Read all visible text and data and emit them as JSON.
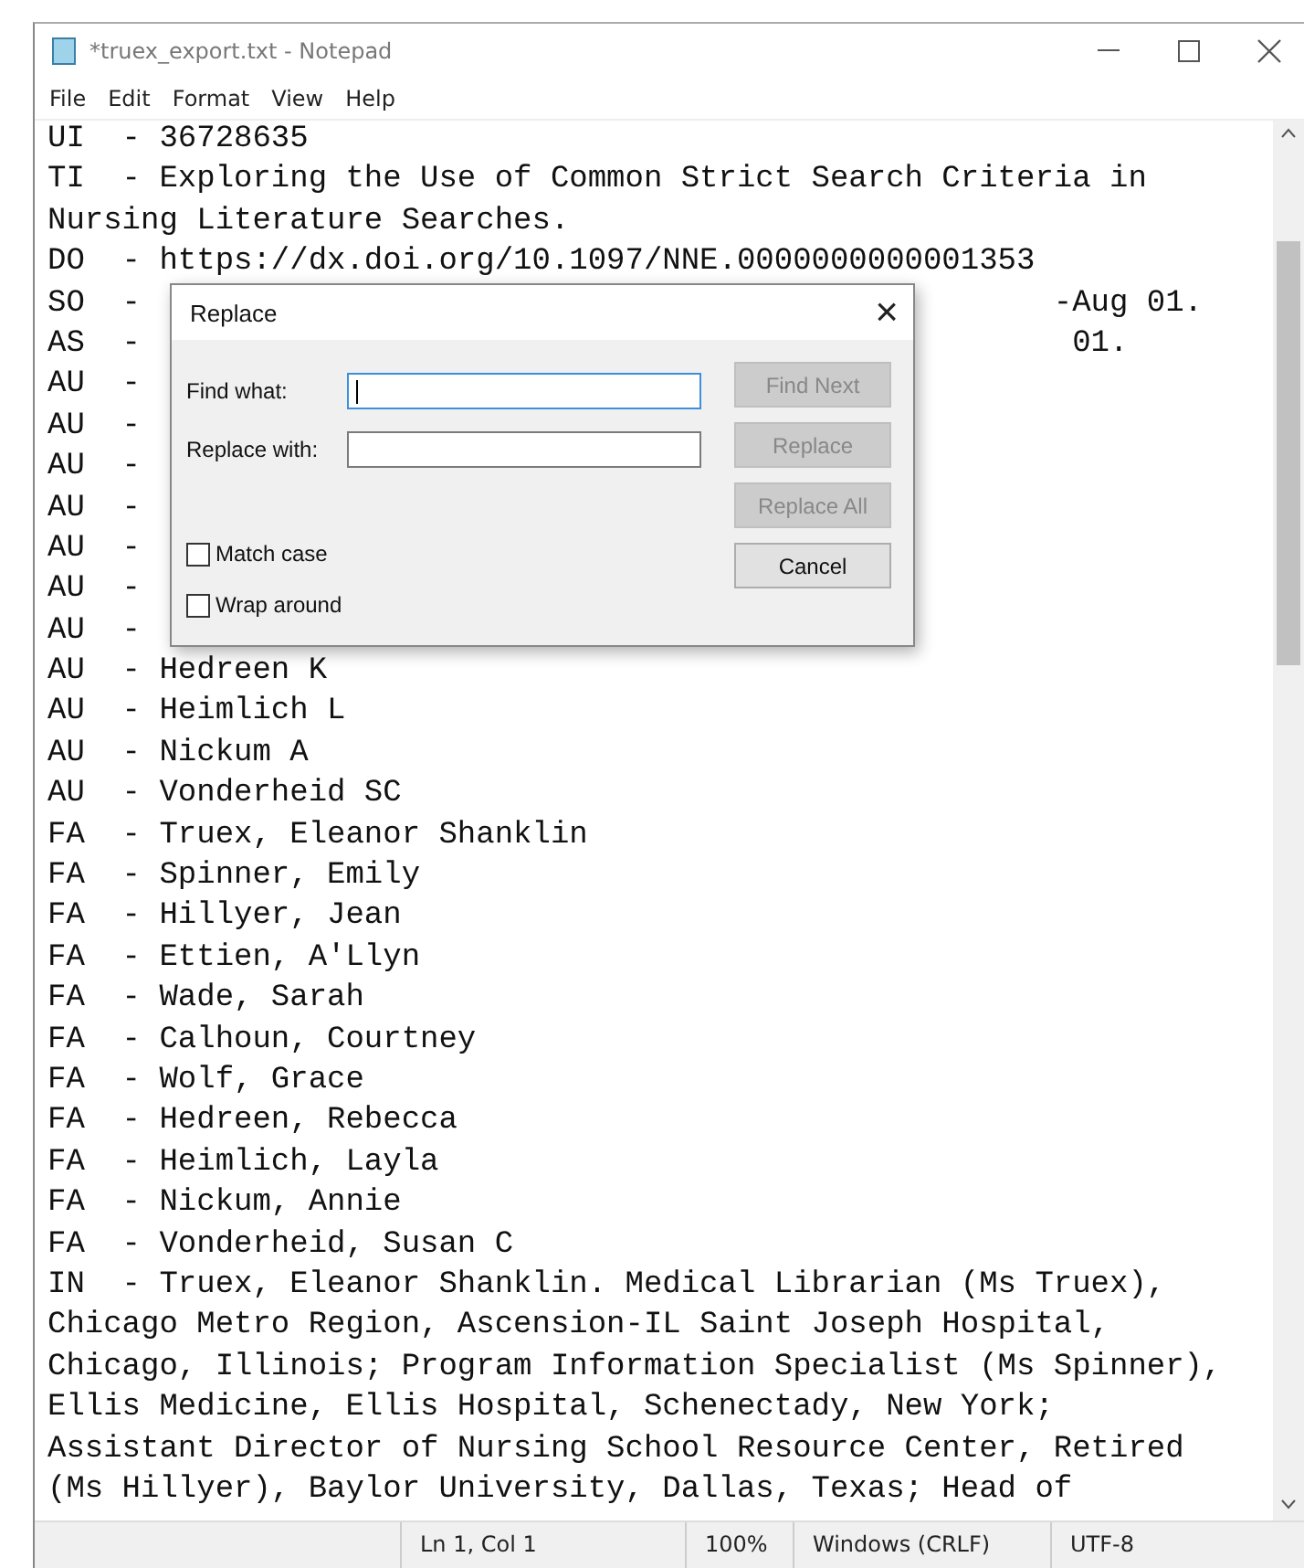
{
  "window": {
    "title": "*truex_export.txt - Notepad"
  },
  "menu": [
    "File",
    "Edit",
    "Format",
    "View",
    "Help"
  ],
  "lines": [
    {
      "text": "UI  - 36728635"
    },
    {
      "text": "TI  - Exploring the Use of Common Strict Search Criteria in"
    },
    {
      "text": "Nursing Literature Searches."
    },
    {
      "text": "DO  - https://dx.doi.org/10.1097/NNE.0000000000001353"
    },
    {
      "text": "SO  -",
      "tail": "-Aug 01."
    },
    {
      "text": "AS  -",
      "tail": "01."
    },
    {
      "text": "AU  -"
    },
    {
      "text": "AU  -"
    },
    {
      "text": "AU  -"
    },
    {
      "text": "AU  -"
    },
    {
      "text": "AU  -"
    },
    {
      "text": "AU  -"
    },
    {
      "text": "AU  -"
    },
    {
      "text": "AU  - Hedreen K"
    },
    {
      "text": "AU  - Heimlich L"
    },
    {
      "text": "AU  - Nickum A"
    },
    {
      "text": "AU  - Vonderheid SC"
    },
    {
      "text": "FA  - Truex, Eleanor Shanklin"
    },
    {
      "text": "FA  - Spinner, Emily"
    },
    {
      "text": "FA  - Hillyer, Jean"
    },
    {
      "text": "FA  - Ettien, A'Llyn"
    },
    {
      "text": "FA  - Wade, Sarah"
    },
    {
      "text": "FA  - Calhoun, Courtney"
    },
    {
      "text": "FA  - Wolf, Grace"
    },
    {
      "text": "FA  - Hedreen, Rebecca"
    },
    {
      "text": "FA  - Heimlich, Layla"
    },
    {
      "text": "FA  - Nickum, Annie"
    },
    {
      "text": "FA  - Vonderheid, Susan C"
    },
    {
      "text": "IN  - Truex, Eleanor Shanklin. Medical Librarian (Ms Truex),"
    },
    {
      "text": "Chicago Metro Region, Ascension-IL Saint Joseph Hospital,"
    },
    {
      "text": "Chicago, Illinois; Program Information Specialist (Ms Spinner),"
    },
    {
      "text": "Ellis Medicine, Ellis Hospital, Schenectady, New York;"
    },
    {
      "text": "Assistant Director of Nursing School Resource Center, Retired"
    },
    {
      "text": "(Ms Hillyer), Baylor University, Dallas, Texas; Head of"
    }
  ],
  "dialog": {
    "title": "Replace",
    "close": "×",
    "fields": [
      {
        "label": "Find what:",
        "focused": true
      },
      {
        "label": "Replace with:",
        "focused": false
      }
    ],
    "buttons": [
      {
        "label": "Find Next",
        "disabled": true
      },
      {
        "label": "Replace",
        "disabled": true
      },
      {
        "label": "Replace All",
        "disabled": true
      },
      {
        "label": "Cancel",
        "disabled": false
      }
    ],
    "checkboxes": [
      {
        "label": "Match case",
        "checked": false
      },
      {
        "label": "Wrap around",
        "checked": false
      }
    ]
  },
  "status_bar": [
    "Ln 1, Col 1",
    "100%",
    "Windows (CRLF)",
    "UTF-8"
  ]
}
